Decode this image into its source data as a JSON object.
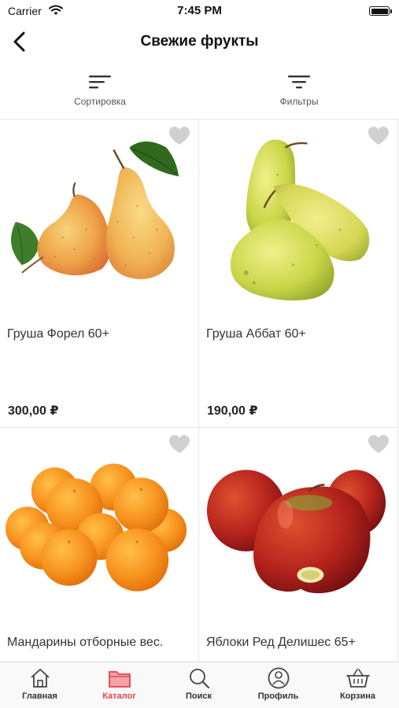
{
  "status_bar": {
    "carrier": "Carrier",
    "time": "7:45 PM"
  },
  "nav": {
    "title": "Свежие фрукты"
  },
  "toolbar": {
    "sort_label": "Сортировка",
    "filter_label": "Фильтры"
  },
  "products": [
    {
      "name": "Груша Форел 60+",
      "price": "300,00 ₽",
      "image": "forelle-pears"
    },
    {
      "name": "Груша Аббат 60+",
      "price": "190,00 ₽",
      "image": "abate-pears"
    },
    {
      "name": "Мандарины отборные вес.",
      "price": "",
      "image": "mandarins"
    },
    {
      "name": "Яблоки Ред Делишес 65+",
      "price": "",
      "image": "red-apples"
    }
  ],
  "tabbar": {
    "items": [
      {
        "label": "Главная",
        "icon": "home-icon"
      },
      {
        "label": "Каталог",
        "icon": "folder-icon",
        "active": true
      },
      {
        "label": "Поиск",
        "icon": "search-icon"
      },
      {
        "label": "Профиль",
        "icon": "user-icon"
      },
      {
        "label": "Корзина",
        "icon": "basket-icon"
      }
    ]
  },
  "colors": {
    "accent": "#e8424e",
    "heart": "#d0d0d0",
    "text": "#333333"
  }
}
